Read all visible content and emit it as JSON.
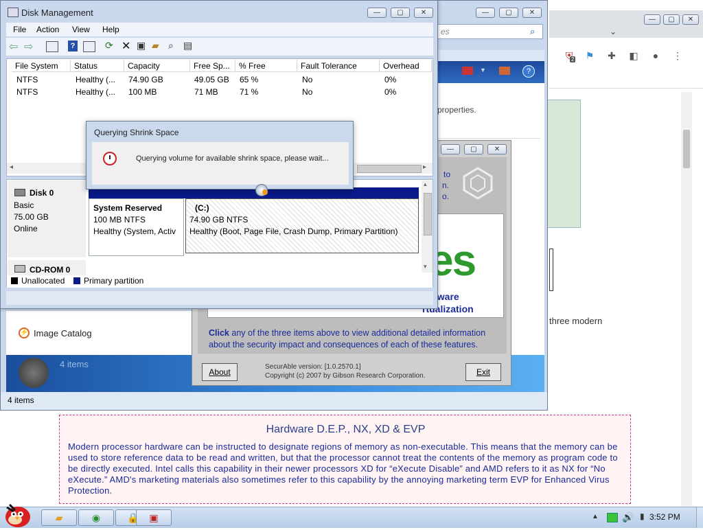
{
  "browser": {
    "toolbar_icons": [
      "shield-badge-icon",
      "flag-icon",
      "puzzle-icon",
      "sidebar-icon",
      "profile-icon",
      "menu-icon"
    ],
    "badge_count": "2",
    "partial_text_lines": [
      "three modern"
    ]
  },
  "explorer": {
    "search_placeholder": "es",
    "partial_text": "properties.",
    "sidebar_item": "Image Catalog",
    "item_count_overlay": "4 items",
    "status_bar": "4 items"
  },
  "diskmgmt": {
    "title": "Disk Management",
    "menu": [
      "File",
      "Action",
      "View",
      "Help"
    ],
    "columns": [
      "File System",
      "Status",
      "Capacity",
      "Free Sp...",
      "% Free",
      "Fault Tolerance",
      "Overhead"
    ],
    "rows": [
      [
        "NTFS",
        "Healthy (...",
        "74.90 GB",
        "49.05 GB",
        "65 %",
        "No",
        "0%"
      ],
      [
        "NTFS",
        "Healthy (...",
        "100 MB",
        "71 MB",
        "71 %",
        "No",
        "0%"
      ]
    ],
    "disk0": {
      "name": "Disk 0",
      "type": "Basic",
      "size": "75.00 GB",
      "status": "Online"
    },
    "partition1": {
      "name": "System Reserved",
      "size": "100 MB NTFS",
      "status": "Healthy (System, Activ"
    },
    "partition2": {
      "name": "(C:)",
      "size": "74.90 GB NTFS",
      "status": "Healthy (Boot, Page File, Crash Dump, Primary Partition)"
    },
    "cdrom": "CD-ROM 0",
    "legend": {
      "unallocated": "Unallocated",
      "primary": "Primary partition"
    }
  },
  "dialog": {
    "title": "Querying Shrink Space",
    "message": "Querying volume for available shrink space, please wait..."
  },
  "securable": {
    "partial_lines": [
      "to",
      "n.",
      "o."
    ],
    "big_text": "es",
    "feature_line1": "ardware",
    "feature_line2": "rtualization",
    "click_bold": "Click",
    "click_rest": " any of the three items above to view additional detailed information about the security impact and consequences of each of these features.",
    "about": "About",
    "exit": "Exit",
    "version": "SecurAble version: [1.0.2570.1]",
    "copyright": "Copyright (c) 2007 by Gibson Research Corporation."
  },
  "article": {
    "title": "Hardware D.E.P., NX, XD & EVP",
    "paragraph": "Modern processor hardware can be instructed to designate regions of memory as non-executable. This means that the memory can be used to store reference data to be read and written, but that the processor cannot treat the contents of the memory as program code to be directly executed. Intel calls this capability in their newer processors XD for “eXecute Disable” and AMD refers to it as NX for “No eXecute.” AMD's marketing materials also sometimes refer to this capability by the annoying marketing term EVP for Enhanced Virus Protection."
  },
  "taskbar": {
    "clock": "3:52 PM"
  },
  "colors": {
    "disk_header_blue": "#0a1a8c",
    "green_text": "#2e9a2e",
    "securable_link_blue": "#1a2b9a",
    "article_title": "#2a3f8a"
  }
}
